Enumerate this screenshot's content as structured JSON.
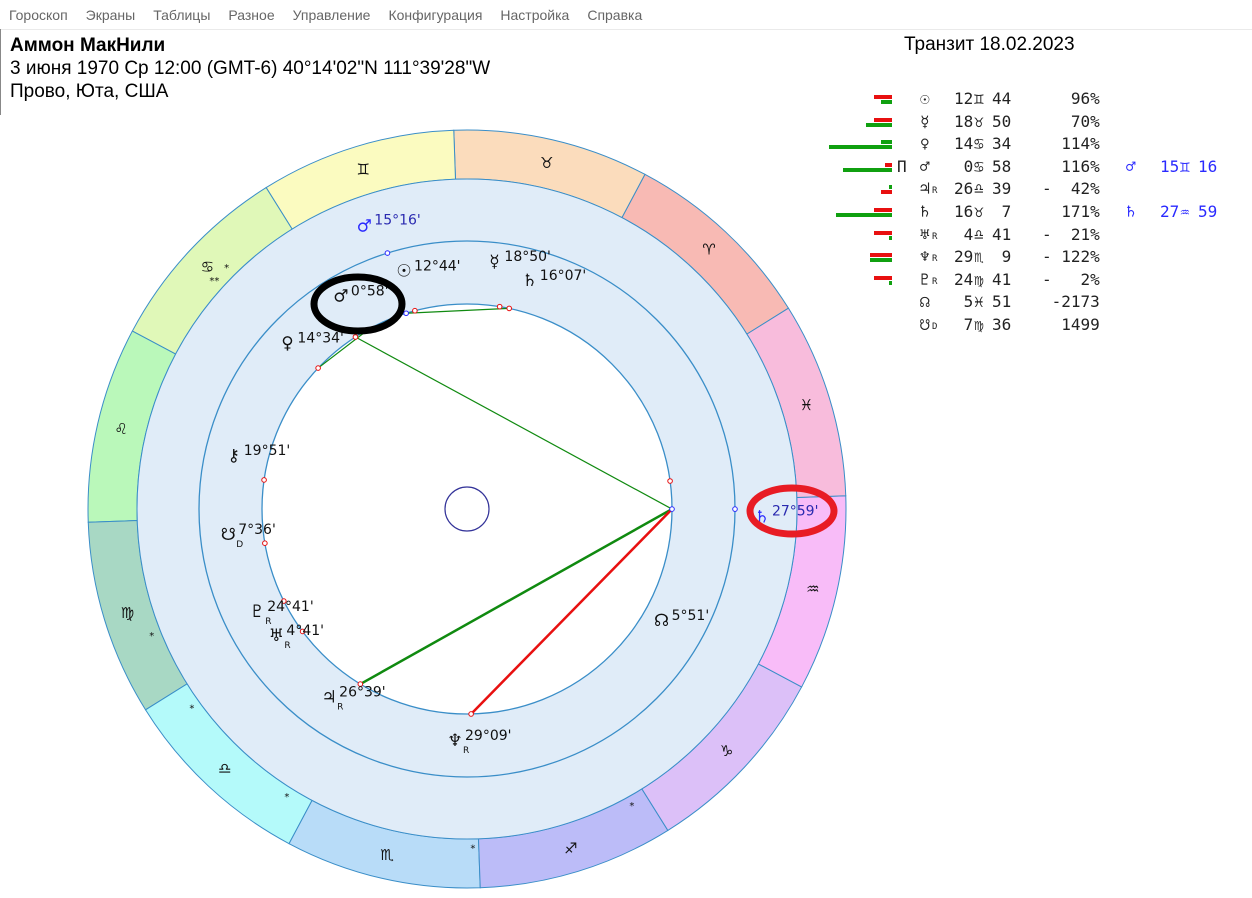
{
  "menu": [
    "Гороскоп",
    "Экраны",
    "Таблицы",
    "Разное",
    "Управление",
    "Конфигурация",
    "Настройка",
    "Справка"
  ],
  "person": {
    "name": "Аммон МакНили",
    "details": "3 июня 1970  Ср  12:00 (GMT-6) 40°14'02\"N  111°39'28\"W",
    "place": "Прово, Юта, США"
  },
  "transit_title": "Транзит 18.02.2023",
  "colors": {
    "bar_red": "#e81010",
    "bar_green": "#10a010",
    "transit": "#2a2aff",
    "ring_line": "#3a8ec8",
    "wheel_fill": "#e0ecf8",
    "aspect_green": "#108a10",
    "aspect_red": "#e81010"
  },
  "table": [
    {
      "glyph": "☉",
      "retro": "",
      "deg": "12",
      "sign": "♊",
      "min": "44",
      "pct": "   96%",
      "bars": [
        {
          "c": "red",
          "v": 18
        },
        {
          "c": "green",
          "v": 11
        }
      ]
    },
    {
      "glyph": "☿",
      "retro": "",
      "deg": "18",
      "sign": "♉",
      "min": "50",
      "pct": "   70%",
      "bars": [
        {
          "c": "red",
          "v": 18
        },
        {
          "c": "green",
          "v": 26
        }
      ]
    },
    {
      "glyph": "♀",
      "retro": "",
      "deg": "14",
      "sign": "♋",
      "min": "34",
      "pct": "  114%",
      "bars": [
        {
          "c": "green",
          "v": 11
        },
        {
          "c": "green",
          "v": 63
        }
      ]
    },
    {
      "glyph": "♂",
      "retro": "",
      "mark": "П",
      "deg": " 0",
      "sign": "♋",
      "min": "58",
      "pct": "  116%",
      "bars": [
        {
          "c": "red",
          "v": 7
        },
        {
          "c": "green",
          "v": 49
        }
      ],
      "transit": {
        "glyph": "♂",
        "deg": "15",
        "sign": "♊",
        "min": "16"
      }
    },
    {
      "glyph": "♃",
      "retro": "R",
      "deg": "26",
      "sign": "♎",
      "min": "39",
      "pct": "-  42%",
      "bars": [
        {
          "c": "green",
          "v": 3
        },
        {
          "c": "red",
          "v": 11
        }
      ]
    },
    {
      "glyph": "♄",
      "retro": "",
      "deg": "16",
      "sign": "♉",
      "min": " 7",
      "pct": "  171%",
      "bars": [
        {
          "c": "red",
          "v": 18
        },
        {
          "c": "green",
          "v": 56
        }
      ],
      "transit": {
        "glyph": "♄",
        "deg": "27",
        "sign": "♒",
        "min": "59"
      }
    },
    {
      "glyph": "♅",
      "retro": "R",
      "deg": " 4",
      "sign": "♎",
      "min": "41",
      "pct": "-  21%",
      "bars": [
        {
          "c": "red",
          "v": 18
        },
        {
          "c": "green",
          "v": 3
        }
      ]
    },
    {
      "glyph": "♆",
      "retro": "R",
      "deg": "29",
      "sign": "♏",
      "min": " 9",
      "pct": "- 122%",
      "bars": [
        {
          "c": "red",
          "v": 22
        },
        {
          "c": "green",
          "v": 22
        }
      ]
    },
    {
      "glyph": "♇",
      "retro": "R",
      "deg": "24",
      "sign": "♍",
      "min": "41",
      "pct": "-   2%",
      "bars": [
        {
          "c": "red",
          "v": 18
        },
        {
          "c": "green",
          "v": 3
        }
      ]
    },
    {
      "glyph": "☊",
      "retro": "",
      "deg": " 5",
      "sign": "♓",
      "min": "51",
      "pct": " -2173",
      "bars": []
    },
    {
      "glyph": "☋",
      "retro": "D",
      "deg": " 7",
      "sign": "♍",
      "min": "36",
      "pct": "  1499",
      "bars": []
    }
  ],
  "wheel": {
    "signs": [
      {
        "glyph": "♈",
        "color": "#f8bab4"
      },
      {
        "glyph": "♉",
        "color": "#fbdcbc"
      },
      {
        "glyph": "♊",
        "color": "#fbfbc0"
      },
      {
        "glyph": "♋",
        "color": "#e0f8b8"
      },
      {
        "glyph": "♌",
        "color": "#baf8ba"
      },
      {
        "glyph": "♍",
        "color": "#a8d8c4"
      },
      {
        "glyph": "♎",
        "color": "#b4fafa"
      },
      {
        "glyph": "♏",
        "color": "#b8dcf8"
      },
      {
        "glyph": "♐",
        "color": "#bcbcf8"
      },
      {
        "glyph": "♑",
        "color": "#dcc0f8"
      },
      {
        "glyph": "♒",
        "color": "#f8bcf8"
      },
      {
        "glyph": "♓",
        "color": "#f8bcdc"
      }
    ],
    "stars": [
      {
        "lon": 103,
        "text": "*"
      },
      {
        "lon": 106,
        "text": "**"
      },
      {
        "lon": 170,
        "text": "*"
      },
      {
        "lon": 184,
        "text": "*"
      },
      {
        "lon": 206,
        "text": "*"
      },
      {
        "lon": 239,
        "text": "*"
      },
      {
        "lon": 267,
        "text": "*"
      }
    ],
    "natal": [
      {
        "id": "sun",
        "glyph": "☉",
        "sub": "",
        "lon": 72.73,
        "label": "12°44'"
      },
      {
        "id": "mercury",
        "glyph": "☿",
        "sub": "",
        "lon": 48.83,
        "label": "18°50'"
      },
      {
        "id": "saturn",
        "glyph": "♄",
        "sub": "",
        "lon": 46.12,
        "label": "16°07'"
      },
      {
        "id": "mars",
        "glyph": "♂",
        "sub": "",
        "lon": 90.97,
        "label": "0°58'"
      },
      {
        "id": "venus",
        "glyph": "♀",
        "sub": "",
        "lon": 104.57,
        "label": "14°34'"
      },
      {
        "id": "chiron",
        "glyph": "⚷",
        "sub": "",
        "lon": 139.85,
        "label": "19°51'"
      },
      {
        "id": "south-node",
        "glyph": "☋",
        "sub": "D",
        "lon": 157.6,
        "label": "7°36'"
      },
      {
        "id": "pluto",
        "glyph": "♇",
        "sub": "R",
        "lon": 174.68,
        "label": "24°41'"
      },
      {
        "id": "uranus",
        "glyph": "♅",
        "sub": "R",
        "lon": 184.68,
        "label": "4°41'"
      },
      {
        "id": "jupiter",
        "glyph": "♃",
        "sub": "R",
        "lon": 206.65,
        "label": "26°39'"
      },
      {
        "id": "neptune",
        "glyph": "♆",
        "sub": "R",
        "lon": 239.15,
        "label": "29°09'"
      },
      {
        "id": "north-node",
        "glyph": "☊",
        "sub": "",
        "lon": 335.85,
        "label": "5°51'"
      }
    ],
    "transits": [
      {
        "id": "transit-mars",
        "glyph": "♂",
        "lon": 75.27,
        "label": "15°16'"
      },
      {
        "id": "transit-saturn",
        "glyph": "♄",
        "lon": 327.98,
        "label": "27°59'"
      }
    ],
    "aspects": [
      {
        "from": 327.98,
        "to": 206.65,
        "color": "green",
        "thick": true
      },
      {
        "from": 327.98,
        "to": 239.15,
        "color": "red",
        "thick": true
      },
      {
        "from": 327.98,
        "to": 90.97,
        "color": "green",
        "thick": false
      },
      {
        "from": 75.27,
        "to": 46.12,
        "color": "green",
        "thick": false
      },
      {
        "from": 104.57,
        "to": 86.5,
        "color": "green",
        "thick": false
      }
    ]
  }
}
